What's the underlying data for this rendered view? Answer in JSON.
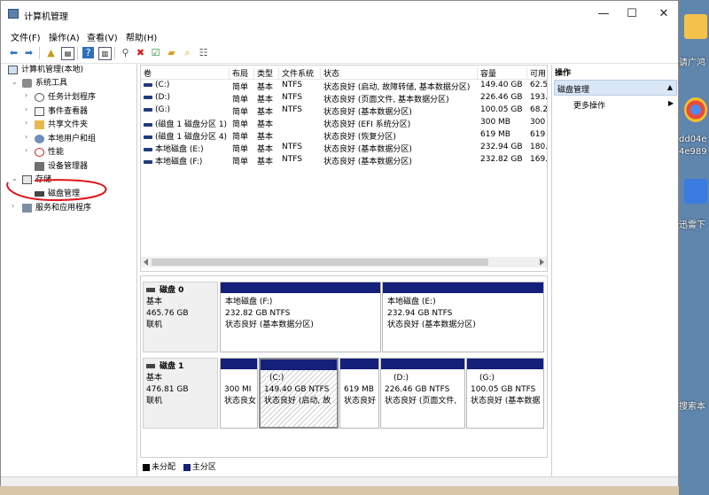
{
  "window": {
    "title": "计算机管理",
    "minimize": "—",
    "maximize": "☐",
    "close": "✕"
  },
  "menu": [
    "文件(F)",
    "操作(A)",
    "查看(V)",
    "帮助(H)"
  ],
  "tree": {
    "root": "计算机管理(本地)",
    "system_tools": "系统工具",
    "task_scheduler": "任务计划程序",
    "event_viewer": "事件查看器",
    "shared_folders": "共享文件夹",
    "local_users": "本地用户和组",
    "performance": "性能",
    "device_manager": "设备管理器",
    "storage": "存储",
    "disk_management": "磁盘管理",
    "services_apps": "服务和应用程序"
  },
  "volume_table": {
    "headers": [
      "卷",
      "布局",
      "类型",
      "文件系统",
      "状态",
      "容量",
      "可用"
    ],
    "rows": [
      {
        "vol": "(C:)",
        "layout": "简单",
        "type": "基本",
        "fs": "NTFS",
        "status": "状态良好 (启动, 故障转储, 基本数据分区)",
        "cap": "149.40 GB",
        "free": "62.5"
      },
      {
        "vol": "(D:)",
        "layout": "简单",
        "type": "基本",
        "fs": "NTFS",
        "status": "状态良好 (页面文件, 基本数据分区)",
        "cap": "226.46 GB",
        "free": "193."
      },
      {
        "vol": "(G:)",
        "layout": "简单",
        "type": "基本",
        "fs": "NTFS",
        "status": "状态良好 (基本数据分区)",
        "cap": "100.05 GB",
        "free": "68.2"
      },
      {
        "vol": "(磁盘 1 磁盘分区 1)",
        "layout": "简单",
        "type": "基本",
        "fs": "",
        "status": "状态良好 (EFI 系统分区)",
        "cap": "300 MB",
        "free": "300"
      },
      {
        "vol": "(磁盘 1 磁盘分区 4)",
        "layout": "简单",
        "type": "基本",
        "fs": "",
        "status": "状态良好 (恢复分区)",
        "cap": "619 MB",
        "free": "619"
      },
      {
        "vol": "本地磁盘 (E:)",
        "layout": "简单",
        "type": "基本",
        "fs": "NTFS",
        "status": "状态良好 (基本数据分区)",
        "cap": "232.94 GB",
        "free": "180."
      },
      {
        "vol": "本地磁盘 (F:)",
        "layout": "简单",
        "type": "基本",
        "fs": "NTFS",
        "status": "状态良好 (基本数据分区)",
        "cap": "232.82 GB",
        "free": "169."
      }
    ]
  },
  "disk0": {
    "name": "磁盘 0",
    "type": "基本",
    "size": "465.76 GB",
    "state": "联机",
    "parts": [
      {
        "name": "本地磁盘  (F:)",
        "size": "232.82 GB NTFS",
        "status": "状态良好 (基本数据分区)"
      },
      {
        "name": "本地磁盘  (E:)",
        "size": "232.94 GB NTFS",
        "status": "状态良好 (基本数据分区)"
      }
    ]
  },
  "disk1": {
    "name": "磁盘 1",
    "type": "基本",
    "size": "476.81 GB",
    "state": "联机",
    "parts": [
      {
        "name": "",
        "size": "300 MI",
        "status": "状态良女"
      },
      {
        "name": "(C:)",
        "size": "149.40 GB NTFS",
        "status": "状态良好 (启动, 故"
      },
      {
        "name": "",
        "size": "619 MB",
        "status": "状态良好"
      },
      {
        "name": "(D:)",
        "size": "226.46 GB NTFS",
        "status": "状态良好 (页面文件,"
      },
      {
        "name": "(G:)",
        "size": "100.05 GB NTFS",
        "status": "状态良好 (基本数据"
      }
    ]
  },
  "legend": {
    "unallocated": "未分配",
    "primary": "主分区"
  },
  "actions": {
    "header": "操作",
    "selected": "磁盘管理",
    "more": "更多操作"
  },
  "desktop": {
    "labels": [
      "请广鸿",
      "dd04e",
      "4e989",
      "迅雷下",
      "搜索本"
    ]
  },
  "colors": {
    "primary_partition": "#14207a",
    "selection": "#d9e6f5",
    "annotation": "#e0151b"
  }
}
